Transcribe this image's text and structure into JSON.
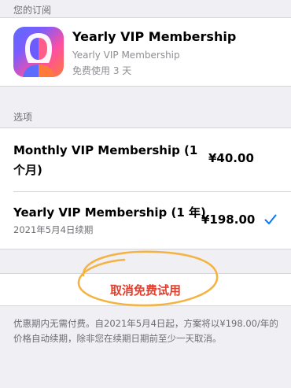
{
  "subscriptions": {
    "header": "您的订阅",
    "item": {
      "title": "Yearly VIP Membership",
      "plan": "Yearly VIP Membership",
      "trial": "免费使用 3 天",
      "icon": "face-app-icon"
    }
  },
  "options": {
    "header": "选项",
    "items": [
      {
        "label": "Monthly VIP Membership (1 个月)",
        "price": "¥40.00",
        "selected": false
      },
      {
        "label": "Yearly VIP Membership (1 年)",
        "price": "¥198.00",
        "renewal": "2021年5月4日续期",
        "selected": true
      }
    ]
  },
  "cancel": {
    "label": "取消免费试用"
  },
  "footer": {
    "text": "优惠期内无需付费。自2021年5月4日起，方案将以¥198.00/年的价格自动续期，除非您在续期日期前至少一天取消。"
  },
  "colors": {
    "accent": "#007aff",
    "cancel": "#e2402f",
    "annotation": "#f5b240"
  }
}
